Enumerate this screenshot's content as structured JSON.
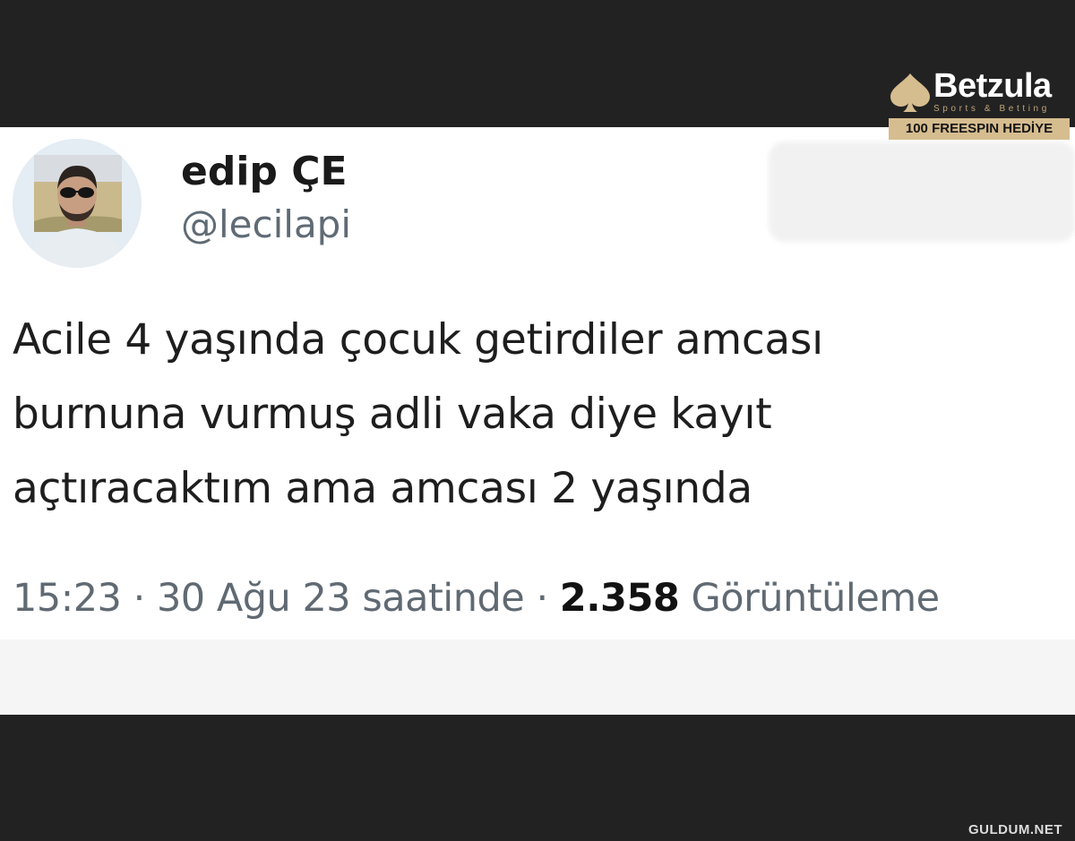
{
  "tweet": {
    "author": {
      "display_name": "edip ÇE",
      "handle": "@lecilapi"
    },
    "text_lines": [
      "Acile 4 yaşında çocuk getirdiler amcası",
      "burnuna vurmuş adli vaka diye kayıt",
      "açtıracaktım ama amcası 2 yaşında"
    ],
    "meta": {
      "time": "15:23",
      "separator": "·",
      "date_text": "30 Ağu 23 saatinde",
      "views_count": "2.358",
      "views_label": "Görüntüleme"
    }
  },
  "branding": {
    "logo_name": "Betzula",
    "logo_tagline": "Sports & Betting",
    "promo": "100 FREESPIN HEDİYE",
    "watermark": "GULDUM.NET"
  },
  "colors": {
    "background": "#222222",
    "card": "#ffffff",
    "gold_accent": "#d6bd8f"
  },
  "icons": {
    "logo_mark": "spade-icon"
  }
}
